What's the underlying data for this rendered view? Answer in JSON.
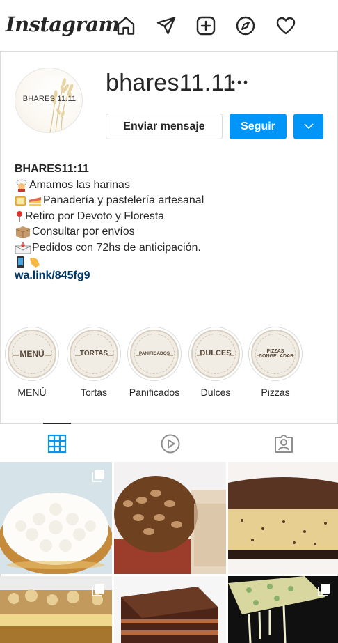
{
  "topnav": {
    "logo": "Instagram",
    "icons": [
      "home-icon",
      "direct-message-icon",
      "new-post-icon",
      "explore-icon",
      "activity-heart-icon"
    ]
  },
  "profile": {
    "avatar_text": "BHARES 11.11",
    "username": "bhares11.11",
    "message_button": "Enviar mensaje",
    "follow_button": "Seguir"
  },
  "bio": {
    "name": "BHARES11:11",
    "lines": [
      {
        "emoji": "cook-emoji",
        "text": "Amamos las harinas"
      },
      {
        "emoji": "bread-cake-emoji",
        "text": "Panadería y pastelería artesanal"
      },
      {
        "emoji": "pin-emoji",
        "text": "Retiro por Devoto y Floresta"
      },
      {
        "emoji": "package-emoji",
        "text": "Consultar por envíos"
      },
      {
        "emoji": "inbox-emoji",
        "text": "Pedidos con 72hs de anticipación."
      },
      {
        "emoji": "phone-point-emoji",
        "text": ""
      }
    ],
    "link": "wa.link/845fg9"
  },
  "highlights": [
    {
      "cover": "MENÚ",
      "label": "MENÚ"
    },
    {
      "cover": "TORTAS",
      "label": "Tortas"
    },
    {
      "cover": "PANIFICADOS",
      "label": "Panificados"
    },
    {
      "cover": "DULCES",
      "label": "Dulces"
    },
    {
      "cover": "PIZZAS CONGELADAS",
      "label": "Pizzas"
    }
  ],
  "tabs": [
    "grid-icon",
    "reels-icon",
    "tagged-icon"
  ],
  "colors": {
    "accent": "#0095f6",
    "link": "#00376b",
    "border": "#dbdbdb",
    "text": "#262626"
  }
}
